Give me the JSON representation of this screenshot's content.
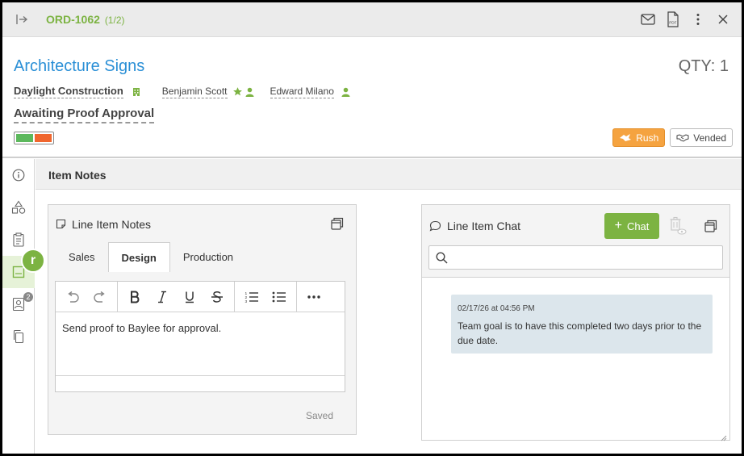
{
  "topbar": {
    "order_id": "ORD-1062",
    "order_count": "(1/2)"
  },
  "item": {
    "title": "Architecture Signs",
    "qty": "QTY: 1",
    "customer": "Daylight Construction",
    "people": [
      {
        "name": "Benjamin Scott",
        "starred": true
      },
      {
        "name": "Edward Milano",
        "starred": false
      }
    ],
    "status": "Awaiting Proof Approval",
    "status_colors": [
      "#5cb85c",
      "#f0662e"
    ],
    "badges": {
      "rush": "Rush",
      "vended": "Vended"
    }
  },
  "sidebar": {
    "avatar_letter": "r",
    "contacts_count": "2",
    "icons": [
      "info-icon",
      "shapes-icon",
      "clipboard-icon",
      "notes-icon",
      "contact-card-icon",
      "copy-icon"
    ]
  },
  "section": {
    "title": "Item Notes"
  },
  "notes_panel": {
    "title": "Line Item Notes",
    "tabs": [
      "Sales",
      "Design",
      "Production"
    ],
    "active_tab": "Design",
    "editor_text": "Send proof to Baylee for approval.",
    "saved_label": "Saved"
  },
  "chat_panel": {
    "title": "Line Item Chat",
    "chat_button": "Chat",
    "search_placeholder": "",
    "messages": [
      {
        "timestamp": "02/17/26 at 04:56 PM",
        "text": "Team goal is to have this completed two days prior to the due date."
      }
    ]
  },
  "colors": {
    "accent_green": "#7cb342",
    "title_blue": "#2a8fd6",
    "rush_orange": "#f5a340"
  }
}
